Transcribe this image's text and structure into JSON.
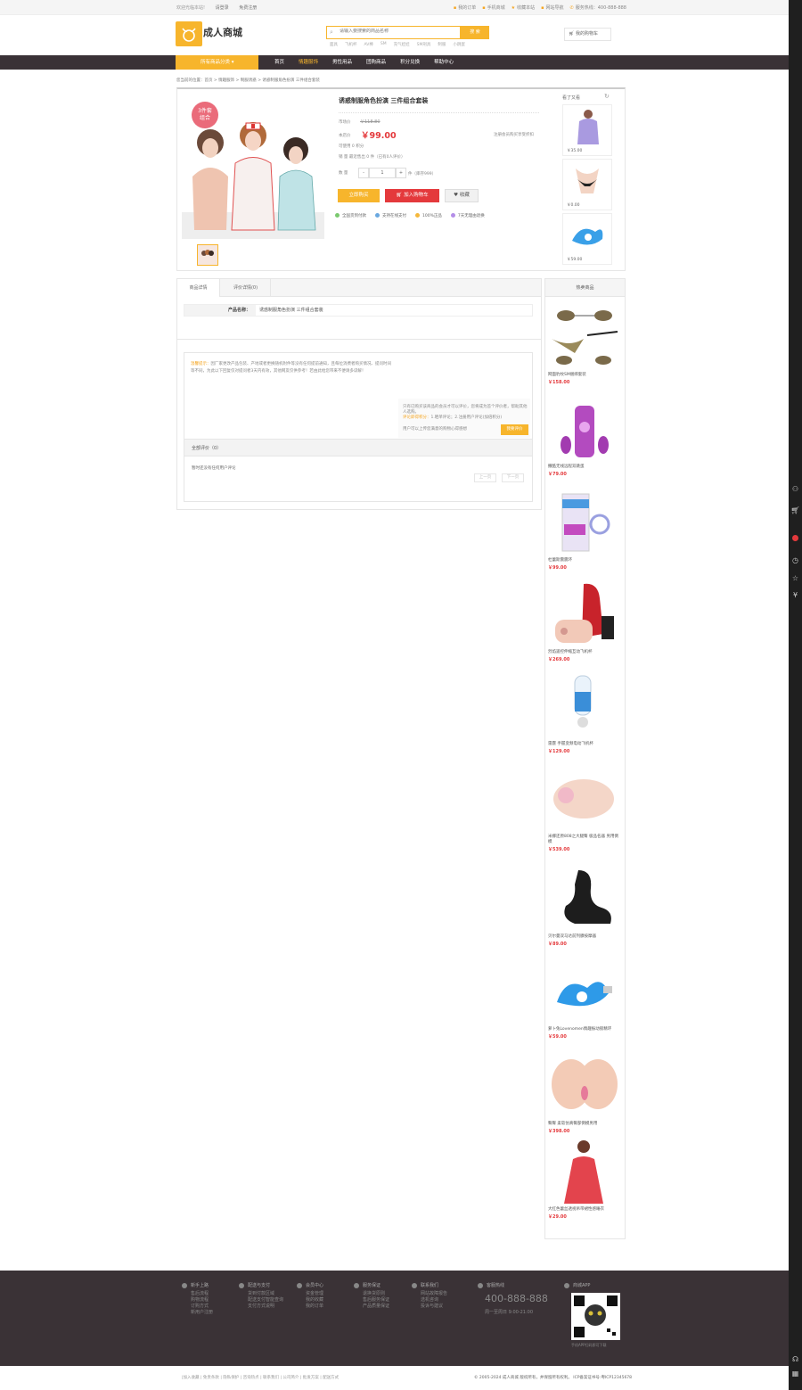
{
  "topbar": {
    "left": [
      "欢迎光临本站!",
      "请登录",
      "免费注册"
    ],
    "right": [
      "我的订单",
      "手机商城",
      "收藏本站",
      "网站导航",
      "服务热线：400-888-888"
    ]
  },
  "logo": {
    "text": "成人商城"
  },
  "search": {
    "placeholder": "请输入要搜索的商品名称",
    "button": "搜 索",
    "hotwords": [
      "面具",
      "飞机杯",
      "AV棒",
      "SM",
      "充气娃娃",
      "SM刑具",
      "制服",
      "小跳蛋"
    ]
  },
  "cart": {
    "label": "我的购物车"
  },
  "nav": {
    "all": "所有商品分类",
    "items": [
      "首页",
      "情趣服饰",
      "男性用品",
      "团购商品",
      "积分兑换",
      "帮助中心"
    ]
  },
  "breadcrumb": "您当前的位置：首页 > 情趣服饰 > 制服诱惑 > 诱惑制服角色扮演 三件组合套装",
  "product": {
    "badge": [
      "3件套",
      "组合"
    ],
    "title": "诱惑制服角色扮演 三件组合套装",
    "market_label": "市场价",
    "market_price": "￥118.80",
    "shop_label": "本店价",
    "shop_price": "￥99.00",
    "member_note": "注册会员购买享受折扣",
    "points": "可使用 0 积分",
    "sales": "销  量    最近售出 0 件（已有0人评价）",
    "qty_label": "数  量",
    "qty_minus": "-",
    "qty_value": "1",
    "qty_plus": "+",
    "qty_stock": "件（库存999）",
    "buy_now": "立即购买",
    "add_cart": "加入购物车",
    "favorite": "收藏",
    "guarantees": [
      "全国货到付款",
      "支持在线支付",
      "100%正品",
      "7天无理由退换"
    ]
  },
  "viewed": {
    "title": "看了又看",
    "items": [
      {
        "price": "￥35.00"
      },
      {
        "price": "￥0.00"
      },
      {
        "price": "￥59.00"
      }
    ]
  },
  "tabs": [
    "商品详情",
    "评价详情(0)"
  ],
  "params": {
    "key": "产品名称：",
    "value": "诱惑制服角色扮演 三件组合套装"
  },
  "notice": {
    "prefix": "温馨提示：",
    "text": "因厂家更改产品包装、产地或者更换随机附件等没有任何提前通知，且每位消费者购买情况、提问时间等不同，为此以下回复仅对提问者3天内有效，其他网友仅供参考！若由此给您带来不便请多谅解！"
  },
  "review_tip": {
    "line1": "只有已购买该商品的会员才可以评价，您将成为首个评价者，帮助其他人选购。",
    "line2_hl": "评论即得积分：",
    "line2": "1.晒单评论；2.注册用户评论(加倍积分)",
    "line3": "用户可以上传您满意的购物心得感想",
    "button": "我要评价"
  },
  "all_reviews": "全部评价（0）",
  "no_reviews": "暂时还没有任何用户评论",
  "pager": {
    "prev": "上一页",
    "next": "下一页"
  },
  "hot": {
    "title": "热卖商品",
    "items": [
      {
        "name": "网面豹纹SM捆绑套装",
        "price": "￥158.00"
      },
      {
        "name": "撒酷无线远程双跳蛋",
        "price": "￥79.00"
      },
      {
        "name": "杜蕾斯震震环",
        "price": "￥99.00"
      },
      {
        "name": "烈焰遥控伸缩互动飞机杯",
        "price": "￥269.00"
      },
      {
        "name": "雷霆 手握变频电动飞机杯",
        "price": "￥129.00"
      },
      {
        "name": "米娜还原808之大腿臀 极品名器 男用倒模",
        "price": "￥539.00"
      },
      {
        "name": "贝尔曼双马达前列腺按摩器",
        "price": "￥89.00"
      },
      {
        "name": "萝卜兔Lovenomen情趣振动锁精环",
        "price": "￥59.00"
      },
      {
        "name": "臀臀 柔软仿真臀部倒模男用",
        "price": "￥398.00"
      },
      {
        "name": "大红色蕾丝透视吊带裙性感睡衣",
        "price": "￥29.00"
      }
    ]
  },
  "footer": {
    "cols": [
      {
        "title": "新手上路",
        "links": [
          "售后流程",
          "购物流程",
          "订购方式",
          "新用户注册"
        ]
      },
      {
        "title": "配送与支付",
        "links": [
          "货到付款区域",
          "配送支付智能查询",
          "支付方式说明"
        ]
      },
      {
        "title": "会员中心",
        "links": [
          "资金管理",
          "我的收藏",
          "我的订单"
        ]
      },
      {
        "title": "服务保证",
        "links": [
          "退换货原则",
          "售后服务保证",
          "产品质量保证"
        ]
      },
      {
        "title": "联系我们",
        "links": [
          "网站故障报告",
          "选机咨询",
          "投诉与建议"
        ]
      }
    ],
    "hotline_title": "客服热线",
    "phone": "400-888-888",
    "hours": "周一至周日 9:00-21:00",
    "app_title": "商城APP",
    "qr_caption": "手机APP扫码即可下载",
    "links": "|加入收藏 | 免责条款 | 隐私保护 | 咨询热点 | 联系我们 | 公司简介 | 批发方案 | 配送方式",
    "copyright": "© 2005-2024 成人商城 版权所有，并保留所有权利。 ICP备案证书号:粤ICP12345678"
  }
}
